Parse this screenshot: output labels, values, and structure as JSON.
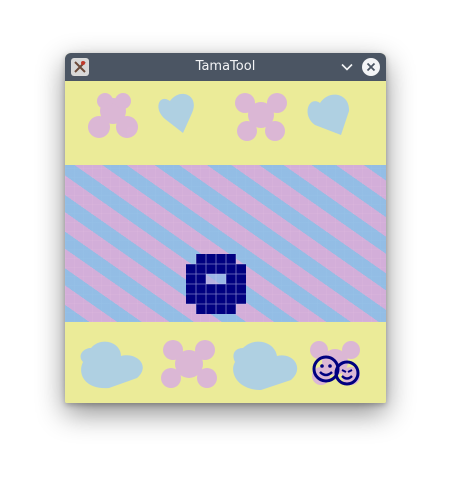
{
  "window": {
    "title": "TamaTool"
  },
  "icons": {
    "app": "tamatool-app-icon",
    "minimize": "chevron-down-icon",
    "close": "close-icon",
    "pet": "pixel-pet-sprite",
    "toy": "smiley-faces-icon"
  },
  "colors": {
    "titlebar": "#4b5563",
    "pixel": "#000080",
    "band_yellow": "#ebeb98",
    "deco_pink": "#d9aee0",
    "deco_blue": "#a9cdea"
  }
}
